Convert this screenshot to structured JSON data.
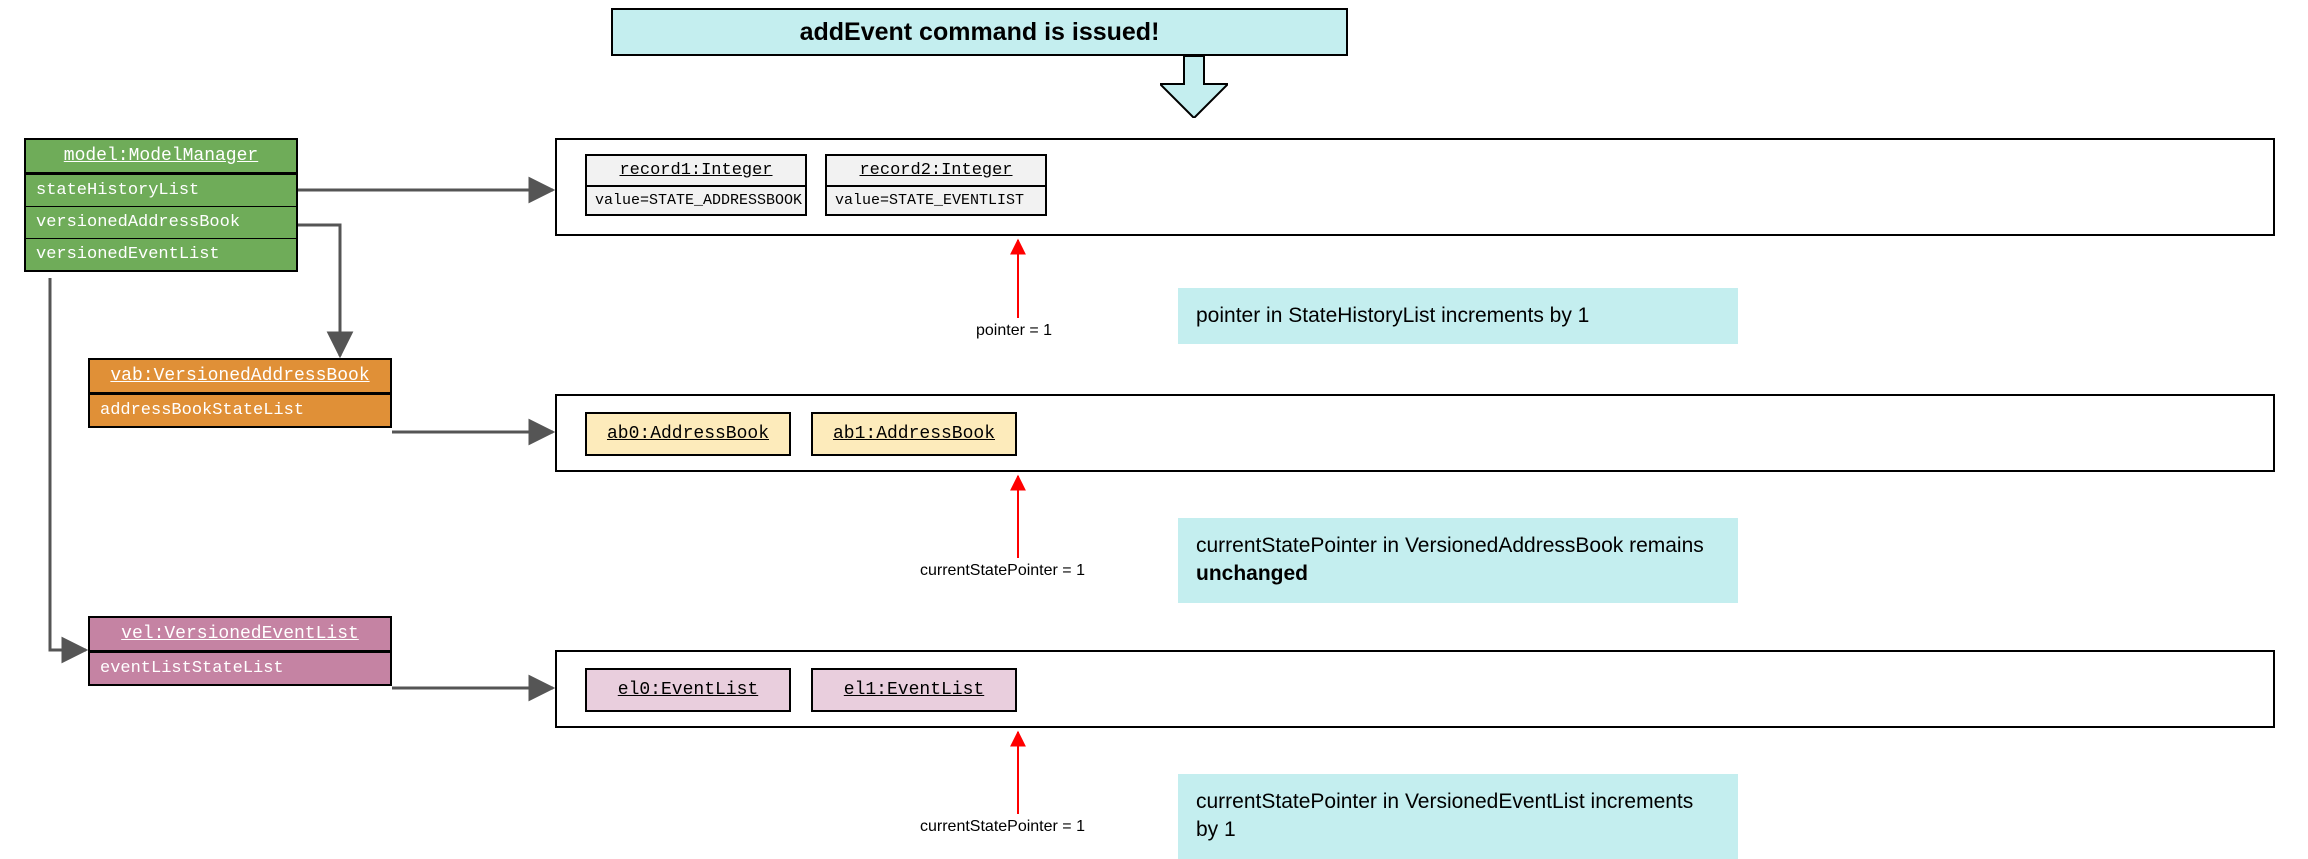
{
  "banner": {
    "text": "addEvent command is issued!"
  },
  "modelManager": {
    "title": "model:ModelManager",
    "fields": {
      "stateHistoryList": "stateHistoryList",
      "versionedAddressBook": "versionedAddressBook",
      "versionedEventList": "versionedEventList"
    }
  },
  "vab": {
    "title": "vab:VersionedAddressBook",
    "field": "addressBookStateList"
  },
  "vel": {
    "title": "vel:VersionedEventList",
    "field": "eventListStateList"
  },
  "records": {
    "r1": {
      "title": "record1:Integer",
      "value": "value=STATE_ADDRESSBOOK"
    },
    "r2": {
      "title": "record2:Integer",
      "value": "value=STATE_EVENTLIST"
    }
  },
  "addressBooks": {
    "ab0": "ab0:AddressBook",
    "ab1": "ab1:AddressBook"
  },
  "eventLists": {
    "el0": "el0:EventList",
    "el1": "el1:EventList"
  },
  "pointers": {
    "p1": "pointer = 1",
    "p2": "currentStatePointer = 1",
    "p3": "currentStatePointer = 1"
  },
  "notes": {
    "n1": "pointer in StateHistoryList increments by 1",
    "n2_a": "currentStatePointer in VersionedAddressBook remains ",
    "n2_b": "unchanged",
    "n3": "currentStatePointer in VersionedEventList increments by 1"
  }
}
